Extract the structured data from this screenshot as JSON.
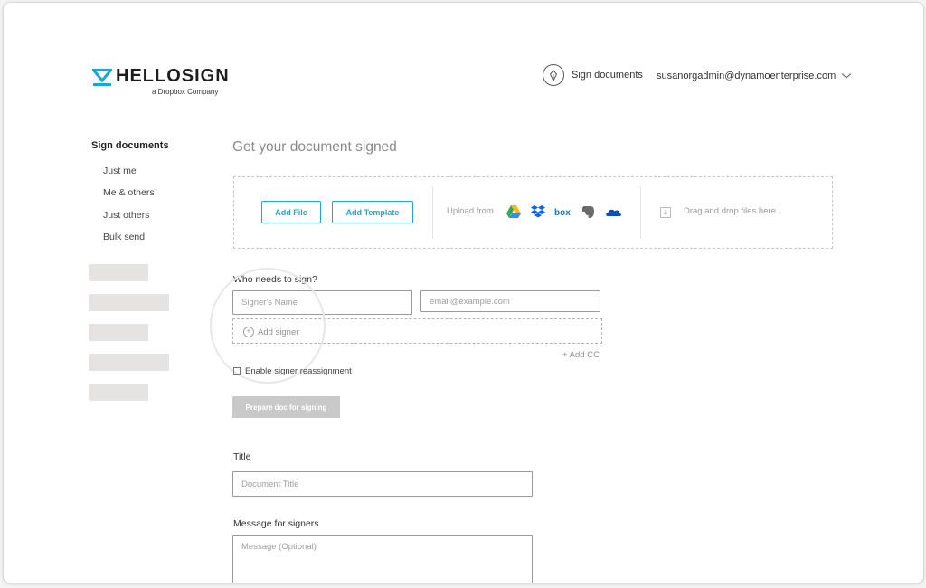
{
  "brand": {
    "name": "HELLOSIGN",
    "subtitle": "a Dropbox Company",
    "accent": "#19a8d3"
  },
  "header": {
    "sign_documents": "Sign documents",
    "user_email": "susanorgadmin@dynamoenterprise.com",
    "pen_icon": "pen-nib-icon",
    "chevron_icon": "chevron-down-icon"
  },
  "sidebar": {
    "title": "Sign documents",
    "items": [
      {
        "label": "Just me"
      },
      {
        "label": "Me & others"
      },
      {
        "label": "Just others"
      },
      {
        "label": "Bulk send"
      }
    ]
  },
  "main": {
    "title": "Get your document signed",
    "upload": {
      "add_file": "Add File",
      "add_template": "Add Template",
      "upload_from": "Upload from",
      "services": [
        "google-drive-icon",
        "dropbox-icon",
        "box-icon",
        "evernote-icon",
        "onedrive-icon"
      ],
      "box_label": "box",
      "drag_drop": "Drag and drop files here"
    },
    "signers": {
      "label": "Who needs to sign?",
      "name_placeholder": "Signer's Name",
      "email_placeholder": "email@example.com",
      "add_signer": "Add signer",
      "add_cc": "+ Add CC",
      "reassign_label": "Enable signer reassignment"
    },
    "prepare_button": "Prepare doc for signing",
    "title_field": {
      "label": "Title",
      "placeholder": "Document Title"
    },
    "message_field": {
      "label": "Message for signers",
      "placeholder": "Message (Optional)"
    }
  }
}
